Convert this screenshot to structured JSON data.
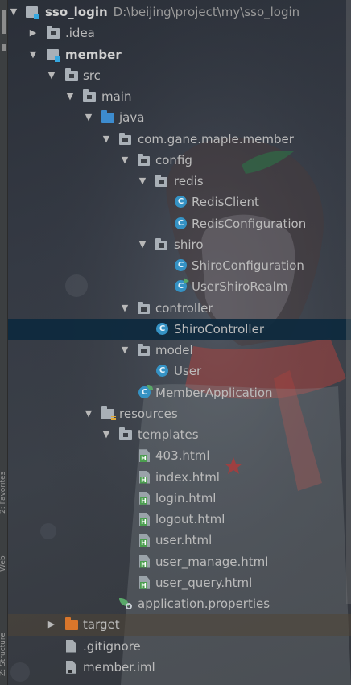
{
  "side_strip": {
    "labels": [
      "2: Favorites",
      "Web",
      "Z: Structure"
    ]
  },
  "tree": {
    "root": {
      "label": "sso_login",
      "path": "D:\\beijing\\project\\my\\sso_login",
      "icon": "module-folder-icon"
    },
    "items": [
      {
        "label": ".idea",
        "icon": "folder-icon"
      },
      {
        "label": "member",
        "icon": "module-folder-icon"
      },
      {
        "label": "src",
        "icon": "folder-icon"
      },
      {
        "label": "main",
        "icon": "folder-icon"
      },
      {
        "label": "java",
        "icon": "source-folder-icon"
      },
      {
        "label": "com.gane.maple.member",
        "icon": "package-icon"
      },
      {
        "label": "config",
        "icon": "package-icon"
      },
      {
        "label": "redis",
        "icon": "package-icon"
      },
      {
        "label": "RedisClient",
        "icon": "class-icon"
      },
      {
        "label": "RedisConfiguration",
        "icon": "class-icon"
      },
      {
        "label": "shiro",
        "icon": "package-icon"
      },
      {
        "label": "ShiroConfiguration",
        "icon": "class-icon"
      },
      {
        "label": "UserShiroRealm",
        "icon": "class-icon"
      },
      {
        "label": "controller",
        "icon": "package-icon"
      },
      {
        "label": "ShiroController",
        "icon": "class-icon"
      },
      {
        "label": "model",
        "icon": "package-icon"
      },
      {
        "label": "User",
        "icon": "class-icon"
      },
      {
        "label": "MemberApplication",
        "icon": "spring-boot-class-icon"
      },
      {
        "label": "resources",
        "icon": "resources-folder-icon"
      },
      {
        "label": "templates",
        "icon": "folder-icon"
      },
      {
        "label": "403.html",
        "icon": "html-file-icon"
      },
      {
        "label": "index.html",
        "icon": "html-file-icon"
      },
      {
        "label": "login.html",
        "icon": "html-file-icon"
      },
      {
        "label": "logout.html",
        "icon": "html-file-icon"
      },
      {
        "label": "user.html",
        "icon": "html-file-icon"
      },
      {
        "label": "user_manage.html",
        "icon": "html-file-icon"
      },
      {
        "label": "user_query.html",
        "icon": "html-file-icon"
      },
      {
        "label": "application.properties",
        "icon": "properties-file-icon"
      },
      {
        "label": "target",
        "icon": "excluded-folder-icon"
      },
      {
        "label": ".gitignore",
        "icon": "text-file-icon"
      },
      {
        "label": "member.iml",
        "icon": "iml-file-icon"
      }
    ],
    "selected": "ShiroController"
  },
  "colors": {
    "selection": "#0d293e",
    "text": "#bbbbbb",
    "class_icon": "#3592c4",
    "source_folder": "#3d8ccf",
    "excluded_folder": "#d9762b",
    "html_badge": "#4b9e4f"
  }
}
